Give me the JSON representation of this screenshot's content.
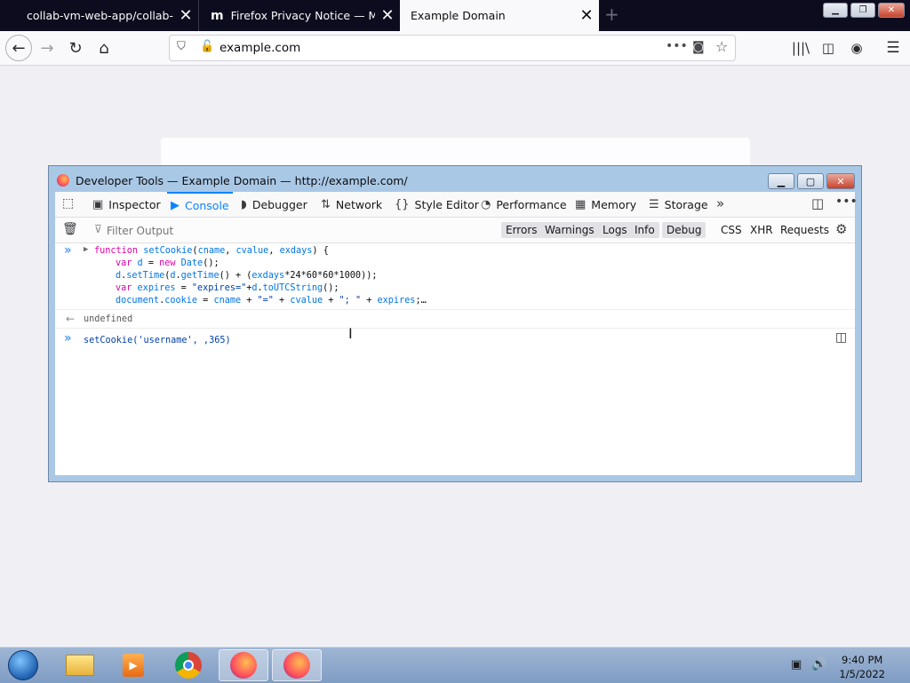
{
  "browser": {
    "tabs": [
      {
        "title": "collab-vm-web-app/collab-vm",
        "selected": false
      },
      {
        "title": "Firefox Privacy Notice — Mozill",
        "selected": false
      },
      {
        "title": "Example Domain",
        "selected": true
      }
    ],
    "url": "example.com"
  },
  "devtools": {
    "title": "Developer Tools — Example Domain — http://example.com/",
    "tabs": [
      "Inspector",
      "Console",
      "Debugger",
      "Network",
      "Style Editor",
      "Performance",
      "Memory",
      "Storage"
    ],
    "selected_tab": "Console",
    "filter_placeholder": "Filter Output",
    "filters": [
      "Errors",
      "Warnings",
      "Logs",
      "Info",
      "Debug",
      "CSS",
      "XHR",
      "Requests"
    ],
    "console": {
      "result": "undefined",
      "input": "setCookie('username', ,365)"
    }
  },
  "taskbar": {
    "time": "9:40 PM",
    "date": "1/5/2022"
  }
}
